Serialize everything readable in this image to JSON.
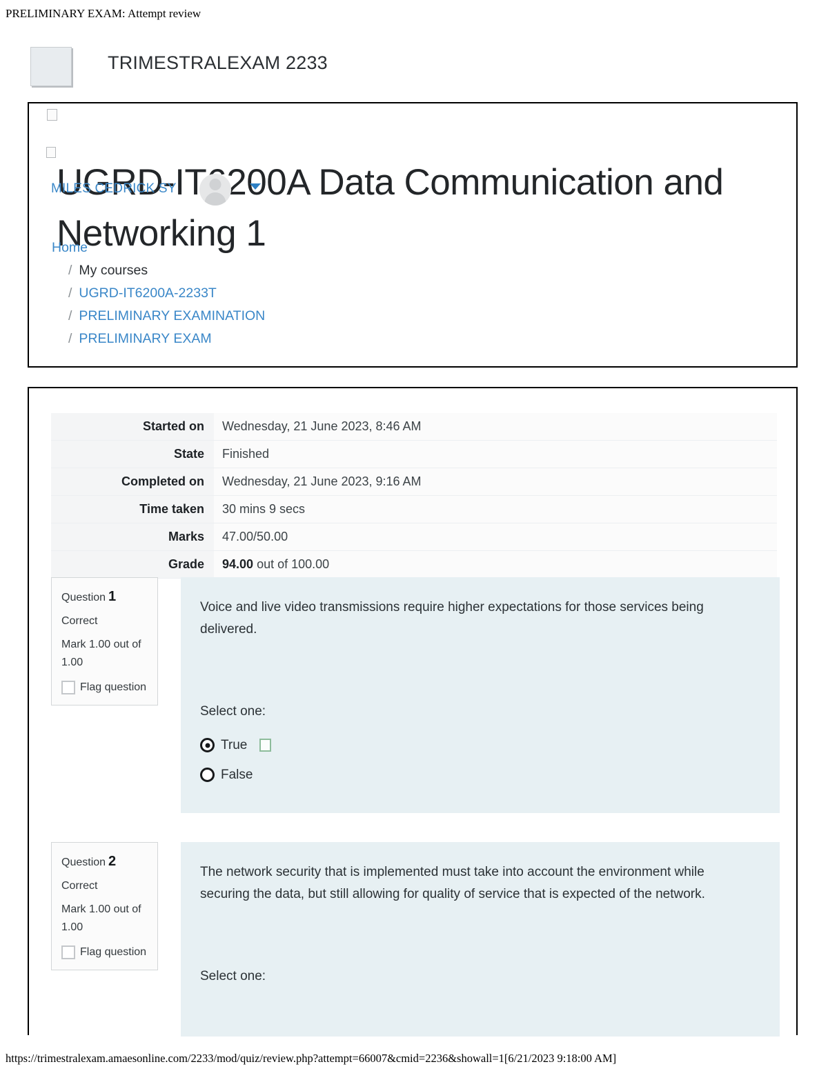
{
  "print": {
    "header_title": "PRELIMINARY EXAM: Attempt review",
    "footer_url": "https://trimestralexam.amaesonline.com/2233/mod/quiz/review.php?attempt=66007&cmid=2236&showall=1[6/21/2023 9:18:00 AM]"
  },
  "brand": {
    "site_name": "TRIMESTRALEXAM 2233",
    "logo_alt": "broken-image-placeholder"
  },
  "header": {
    "page_title": "UGRD-IT6200A Data Communication and Networking 1",
    "user_name": "MILES CEDRICK SY"
  },
  "breadcrumb": [
    {
      "label": "Home",
      "link": true,
      "separator": ""
    },
    {
      "label": "My courses",
      "link": false,
      "separator": "/"
    },
    {
      "label": "UGRD-IT6200A-2233T",
      "link": true,
      "separator": "/"
    },
    {
      "label": "PRELIMINARY EXAMINATION",
      "link": true,
      "separator": "/"
    },
    {
      "label": "PRELIMINARY EXAM",
      "link": true,
      "separator": "/"
    }
  ],
  "summary": {
    "rows": [
      {
        "label": "Started on",
        "value": "Wednesday, 21 June 2023, 8:46 AM"
      },
      {
        "label": "State",
        "value": "Finished"
      },
      {
        "label": "Completed on",
        "value": "Wednesday, 21 June 2023, 9:16 AM"
      },
      {
        "label": "Time taken",
        "value": "30 mins 9 secs"
      },
      {
        "label": "Marks",
        "value": "47.00/50.00"
      }
    ],
    "grade_label": "Grade",
    "grade_value": "94.00",
    "grade_suffix": "out of 100.00"
  },
  "questions": [
    {
      "num_label": "Question",
      "number": "1",
      "state": "Correct",
      "mark": "Mark 1.00 out of 1.00",
      "flag_label": "Flag question",
      "text": "Voice and live video transmissions require higher expectations for those services being delivered.",
      "select_label": "Select one:",
      "options": [
        {
          "label": "True",
          "selected": true,
          "correct_marker": true
        },
        {
          "label": "False",
          "selected": false,
          "correct_marker": false
        }
      ]
    },
    {
      "num_label": "Question",
      "number": "2",
      "state": "Correct",
      "mark": "Mark 1.00 out of 1.00",
      "flag_label": "Flag question",
      "text": "The network security that is implemented must take into account the environment while securing the data, but still allowing for quality of service that is expected of the network.",
      "select_label": "Select one:",
      "options": []
    }
  ],
  "colors": {
    "link": "#3a87c8",
    "question_bg": "#e7f0f3",
    "correct_marker_border": "#8dbc9b",
    "card_border": "#000000"
  }
}
